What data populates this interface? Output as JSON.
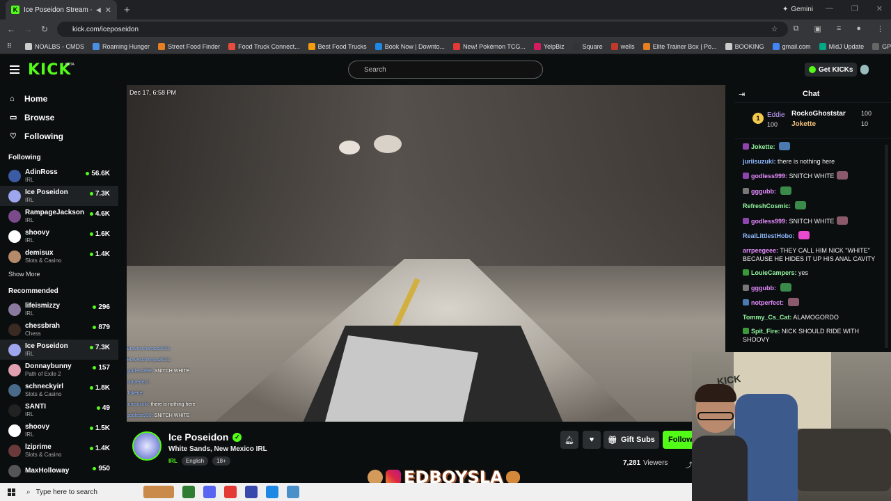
{
  "browser": {
    "tab_title": "Ice Poseidon Stream - Wat",
    "new_tab": "+",
    "close": "✕",
    "gemini": "Gemini",
    "url": "kick.com/iceposeidon",
    "bookmarks": [
      "NOALBS - CMDS",
      "Roaming Hunger",
      "Street Food Finder",
      "Food Truck Connect...",
      "Best Food Trucks",
      "Book Now | Downto...",
      "New! Pokémon TCG...",
      "YelpBiz",
      "Square",
      "wells",
      "Elite Trainer Box | Po...",
      "BOOKING",
      "gmail.com",
      "MidJ Update",
      "GPT"
    ],
    "bookmark_colors": [
      "#ccc",
      "#4a90e2",
      "#e67e22",
      "#e74c3c",
      "#f39c12",
      "#1e88e5",
      "#e53935",
      "#d81b60",
      "#333",
      "#c0392b",
      "#e67e22",
      "#ccc",
      "#4285f4",
      "#00a884",
      "#666"
    ]
  },
  "header": {
    "logo": "KICK",
    "beta": "BETA",
    "search_placeholder": "Search",
    "get_kicks": "Get KICKs"
  },
  "sidebar": {
    "nav": [
      {
        "icon": "⌂",
        "label": "Home"
      },
      {
        "icon": "▭",
        "label": "Browse"
      },
      {
        "icon": "♡",
        "label": "Following"
      }
    ],
    "following_heading": "Following",
    "following": [
      {
        "name": "AdinRoss",
        "cat": "IRL",
        "viewers": "56.6K",
        "color": "#3b5ba5"
      },
      {
        "name": "Ice Poseidon",
        "cat": "IRL",
        "viewers": "7.3K",
        "color": "#9ea6ee"
      },
      {
        "name": "RampageJackson",
        "cat": "IRL",
        "viewers": "4.6K",
        "color": "#7a4a8a"
      },
      {
        "name": "shoovy",
        "cat": "IRL",
        "viewers": "1.6K",
        "color": "#ffffff"
      },
      {
        "name": "demisux",
        "cat": "Slots & Casino",
        "viewers": "1.4K",
        "color": "#b58a6a"
      }
    ],
    "show_more": "Show More",
    "recommended_heading": "Recommended",
    "recommended": [
      {
        "name": "lifeismizzy",
        "cat": "IRL",
        "viewers": "296",
        "color": "#8a7aa0"
      },
      {
        "name": "chessbrah",
        "cat": "Chess",
        "viewers": "879",
        "color": "#3a2a22"
      },
      {
        "name": "Ice Poseidon",
        "cat": "IRL",
        "viewers": "7.3K",
        "color": "#9ea6ee"
      },
      {
        "name": "Donnaybunny",
        "cat": "Path of Exile 2",
        "viewers": "157",
        "color": "#e0a0b0"
      },
      {
        "name": "schneckyirl",
        "cat": "Slots & Casino",
        "viewers": "1.8K",
        "color": "#4a6a8a"
      },
      {
        "name": "SANTI",
        "cat": "IRL",
        "viewers": "49",
        "color": "#222"
      },
      {
        "name": "shoovy",
        "cat": "IRL",
        "viewers": "1.5K",
        "color": "#ffffff"
      },
      {
        "name": "lziprime",
        "cat": "Slots & Casino",
        "viewers": "1.4K",
        "color": "#6a3a3a"
      },
      {
        "name": "MaxHolloway",
        "cat": "",
        "viewers": "950",
        "color": "#555"
      }
    ]
  },
  "video": {
    "timestamp": "Dec 17, 6:58 PM",
    "overlay_chat": [
      {
        "user": "Braveschamps2021:",
        "text": ""
      },
      {
        "user": "Braveschamps2021:",
        "text": ""
      },
      {
        "user": "godless999:",
        "text": "SNITCH WHITE"
      },
      {
        "user": "notperfect:",
        "text": ""
      },
      {
        "user": "Jokette:",
        "text": ""
      },
      {
        "user": "juriisuzuki:",
        "text": "there is nothing here"
      },
      {
        "user": "godless999:",
        "text": "SNITCH WHITE"
      }
    ]
  },
  "channel": {
    "name": "Ice Poseidon",
    "title": "White Sands, New Mexico IRL",
    "category": "IRL",
    "tags": [
      "English",
      "18+"
    ],
    "gift_subs": "Gift Subs",
    "follow_label": "Follow",
    "viewers_count": "7,281",
    "viewers_label": "Viewers",
    "banner_text": "EDBOYSLA"
  },
  "chat": {
    "title": "Chat",
    "pinned": {
      "first": {
        "rank": "1",
        "name": "Eddie",
        "value": "100"
      },
      "second": {
        "name": "RockoGhoststar",
        "value": "100"
      },
      "third": {
        "name": "Jokette",
        "value": "10"
      }
    },
    "messages": [
      {
        "user": "Jokette:",
        "text": "",
        "ucolor": "#93f5a0",
        "badge": "#8e44ad",
        "emote": "#4a7ab0"
      },
      {
        "user": "juriisuzuki:",
        "text": "there is nothing here",
        "ucolor": "#8fb8ff",
        "badge": "",
        "emote": ""
      },
      {
        "user": "godless999:",
        "text": "SNITCH WHITE",
        "ucolor": "#e58cff",
        "badge": "#8e44ad",
        "emote": "#8a5a6a"
      },
      {
        "user": "gggubb:",
        "text": "",
        "ucolor": "#e58cff",
        "badge": "#777",
        "emote": "#3a8a4a"
      },
      {
        "user": "RefreshCosmic:",
        "text": "",
        "ucolor": "#93f5a0",
        "badge": "",
        "emote": "#3a8a4a"
      },
      {
        "user": "godless999:",
        "text": "SNITCH WHITE",
        "ucolor": "#e58cff",
        "badge": "#8e44ad",
        "emote": "#8a5a6a"
      },
      {
        "user": "RealLittlestHobo:",
        "text": "",
        "ucolor": "#8fb8ff",
        "badge": "",
        "emote": "#e84ad0"
      },
      {
        "user": "arrpeegeee:",
        "text": "THEY CALL HIM NICK \"WHITE\" BECAUSE HE HIDES IT UP HIS ANAL CAVITY",
        "ucolor": "#e58cff",
        "badge": "",
        "emote": ""
      },
      {
        "user": "LouieCampers:",
        "text": "yes",
        "ucolor": "#93f5a0",
        "badge": "#3a9a3a",
        "emote": ""
      },
      {
        "user": "gggubb:",
        "text": "",
        "ucolor": "#e58cff",
        "badge": "#777",
        "emote": "#3a8a4a"
      },
      {
        "user": "notperfect:",
        "text": "",
        "ucolor": "#e58cff",
        "badge": "#4a7ab0",
        "emote": "#8a5a6a"
      },
      {
        "user": "Tommy_Cs_Cat:",
        "text": "ALAMOGORDO",
        "ucolor": "#93f5a0",
        "badge": "",
        "emote": ""
      },
      {
        "user": "Spit_Fire:",
        "text": "NICK SHOULD RIDE WITH SHOOVY",
        "ucolor": "#93f5a0",
        "badge": "#3a9a3a",
        "emote": ""
      }
    ]
  },
  "taskbar": {
    "search_placeholder": "Type here to search",
    "icons": [
      "#c98a4a",
      "#2e7d32",
      "#5865f2",
      "#e53935",
      "#3949ab",
      "#1e88e5",
      "#4a90c8"
    ]
  }
}
